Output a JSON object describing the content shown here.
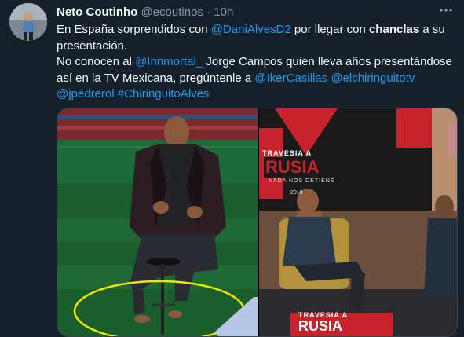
{
  "tweet": {
    "author_name": "Neto Coutinho",
    "author_handle": "@ecoutinos",
    "separator": "·",
    "time": "10h",
    "more_icon": "more-horizontal-icon",
    "text": {
      "l1_a": "En España sorprendidos con ",
      "l1_mention": "@DaniAlvesD2",
      "l1_b": " por llegar con ",
      "l1_bold": "chanclas",
      "l1_c": " a su",
      "l2": "presentación.",
      "l3_a": "No conocen al ",
      "l3_mention": "@Innmortal_",
      "l3_b": " Jorge Campos quien lleva años presentándose",
      "l4_a": "así en la TV Mexicana, pregúntenle a ",
      "l4_mention1": "@IkerCasillas",
      "l4_space": " ",
      "l4_mention2": "@elchiringuitotv",
      "l5_mention": "@jpedrerol",
      "l5_space": " ",
      "l5_hashtag": "#ChiringuitoAlves"
    }
  },
  "media": {
    "right_banner_top_line": "TRAVESIA A",
    "right_banner_main": "RUSIA",
    "right_banner_sub": "NADA NOS DETIENE",
    "right_banner_year": "2018",
    "right_bottom_line": "TRAVESIA A",
    "right_bottom_main": "RUSIA"
  },
  "colors": {
    "background": "#15202b",
    "link": "#1d9bf0",
    "secondary_text": "#8b98a5",
    "circle_highlight": "#f2e600"
  }
}
